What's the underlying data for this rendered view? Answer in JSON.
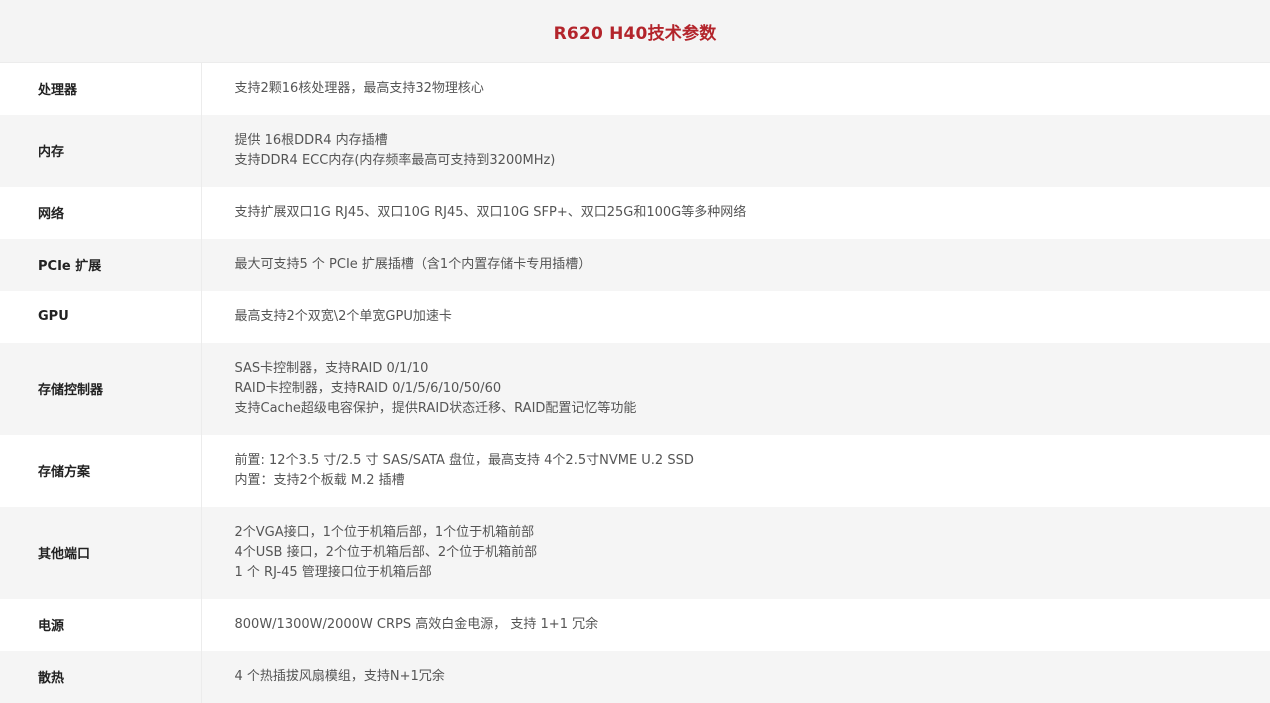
{
  "title": "R620 H40技术参数",
  "rows": [
    {
      "label": "处理器",
      "lines": [
        "支持2颗16核处理器，最高支持32物理核心"
      ]
    },
    {
      "label": "内存",
      "lines": [
        "提供 16根DDR4 内存插槽",
        "支持DDR4 ECC内存(内存频率最高可支持到3200MHz)"
      ]
    },
    {
      "label": "网络",
      "lines": [
        "支持扩展双口1G RJ45、双口10G RJ45、双口10G SFP+、双口25G和100G等多种网络"
      ]
    },
    {
      "label": "PCIe 扩展",
      "lines": [
        "最大可支持5 个 PCIe 扩展插槽（含1个内置存储卡专用插槽）"
      ]
    },
    {
      "label": "GPU",
      "lines": [
        "最高支持2个双宽\\2个单宽GPU加速卡"
      ]
    },
    {
      "label": "存储控制器",
      "lines": [
        "SAS卡控制器，支持RAID 0/1/10",
        "RAID卡控制器，支持RAID 0/1/5/6/10/50/60",
        "支持Cache超级电容保护，提供RAID状态迁移、RAID配置记忆等功能"
      ]
    },
    {
      "label": "存储方案",
      "lines": [
        "前置: 12个3.5 寸/2.5 寸 SAS/SATA 盘位，最高支持 4个2.5寸NVME U.2 SSD",
        "内置：支持2个板载 M.2 插槽"
      ]
    },
    {
      "label": "其他端口",
      "lines": [
        "2个VGA接口，1个位于机箱后部，1个位于机箱前部",
        "4个USB 接口，2个位于机箱后部、2个位于机箱前部",
        "1 个 RJ-45 管理接口位于机箱后部"
      ]
    },
    {
      "label": "电源",
      "lines": [
        "800W/1300W/2000W CRPS 高效白金电源， 支持 1+1 冗余"
      ]
    },
    {
      "label": "散热",
      "lines": [
        "4 个热插拔风扇模组，支持N+1冗余"
      ]
    }
  ]
}
